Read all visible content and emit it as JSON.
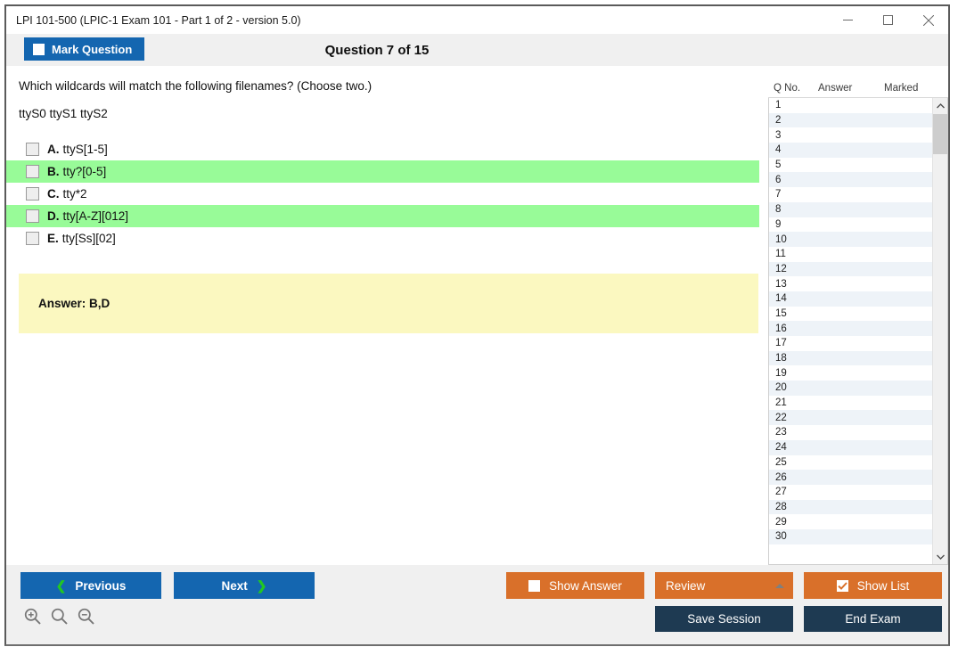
{
  "window": {
    "title": "LPI 101-500 (LPIC-1 Exam 101 - Part 1 of 2 - version 5.0)",
    "controls": {
      "minimize": "minimize-icon",
      "maximize": "maximize-icon",
      "close": "close-icon"
    }
  },
  "header": {
    "mark_question_label": "Mark Question",
    "question_counter": "Question 7 of 15"
  },
  "question": {
    "stem": "Which wildcards will match the following filenames? (Choose two.)",
    "filenames": "ttyS0 ttyS1 ttyS2",
    "options": [
      {
        "letter": "A.",
        "text": "ttyS[1-5]",
        "correct": false,
        "checked": false
      },
      {
        "letter": "B.",
        "text": "tty?[0-5]",
        "correct": true,
        "checked": false
      },
      {
        "letter": "C.",
        "text": "tty*2",
        "correct": false,
        "checked": false
      },
      {
        "letter": "D.",
        "text": "tty[A-Z][012]",
        "correct": true,
        "checked": false
      },
      {
        "letter": "E.",
        "text": "tty[Ss][02]",
        "correct": false,
        "checked": false
      }
    ],
    "answer_text": "Answer: B,D"
  },
  "question_list": {
    "columns": [
      "Q No.",
      "Answer",
      "Marked"
    ],
    "rows": [
      {
        "no": "1",
        "answer": "",
        "marked": ""
      },
      {
        "no": "2",
        "answer": "",
        "marked": ""
      },
      {
        "no": "3",
        "answer": "",
        "marked": ""
      },
      {
        "no": "4",
        "answer": "",
        "marked": ""
      },
      {
        "no": "5",
        "answer": "",
        "marked": ""
      },
      {
        "no": "6",
        "answer": "",
        "marked": ""
      },
      {
        "no": "7",
        "answer": "",
        "marked": ""
      },
      {
        "no": "8",
        "answer": "",
        "marked": ""
      },
      {
        "no": "9",
        "answer": "",
        "marked": ""
      },
      {
        "no": "10",
        "answer": "",
        "marked": ""
      },
      {
        "no": "11",
        "answer": "",
        "marked": ""
      },
      {
        "no": "12",
        "answer": "",
        "marked": ""
      },
      {
        "no": "13",
        "answer": "",
        "marked": ""
      },
      {
        "no": "14",
        "answer": "",
        "marked": ""
      },
      {
        "no": "15",
        "answer": "",
        "marked": ""
      },
      {
        "no": "16",
        "answer": "",
        "marked": ""
      },
      {
        "no": "17",
        "answer": "",
        "marked": ""
      },
      {
        "no": "18",
        "answer": "",
        "marked": ""
      },
      {
        "no": "19",
        "answer": "",
        "marked": ""
      },
      {
        "no": "20",
        "answer": "",
        "marked": ""
      },
      {
        "no": "21",
        "answer": "",
        "marked": ""
      },
      {
        "no": "22",
        "answer": "",
        "marked": ""
      },
      {
        "no": "23",
        "answer": "",
        "marked": ""
      },
      {
        "no": "24",
        "answer": "",
        "marked": ""
      },
      {
        "no": "25",
        "answer": "",
        "marked": ""
      },
      {
        "no": "26",
        "answer": "",
        "marked": ""
      },
      {
        "no": "27",
        "answer": "",
        "marked": ""
      },
      {
        "no": "28",
        "answer": "",
        "marked": ""
      },
      {
        "no": "29",
        "answer": "",
        "marked": ""
      },
      {
        "no": "30",
        "answer": "",
        "marked": ""
      }
    ]
  },
  "footer": {
    "previous_label": "Previous",
    "next_label": "Next",
    "show_answer_label": "Show Answer",
    "show_answer_checked": false,
    "review_label": "Review",
    "show_list_label": "Show List",
    "show_list_checked": true,
    "save_session_label": "Save Session",
    "end_exam_label": "End Exam",
    "zoom_icons": [
      "zoom-in-icon",
      "zoom-reset-icon",
      "zoom-out-icon"
    ]
  },
  "colors": {
    "primary_blue": "#1466b0",
    "orange": "#d9702a",
    "navy": "#1e3a52",
    "correct_green": "#98fb98",
    "answer_yellow": "#fbf8c0",
    "chevron_green": "#22c722"
  }
}
